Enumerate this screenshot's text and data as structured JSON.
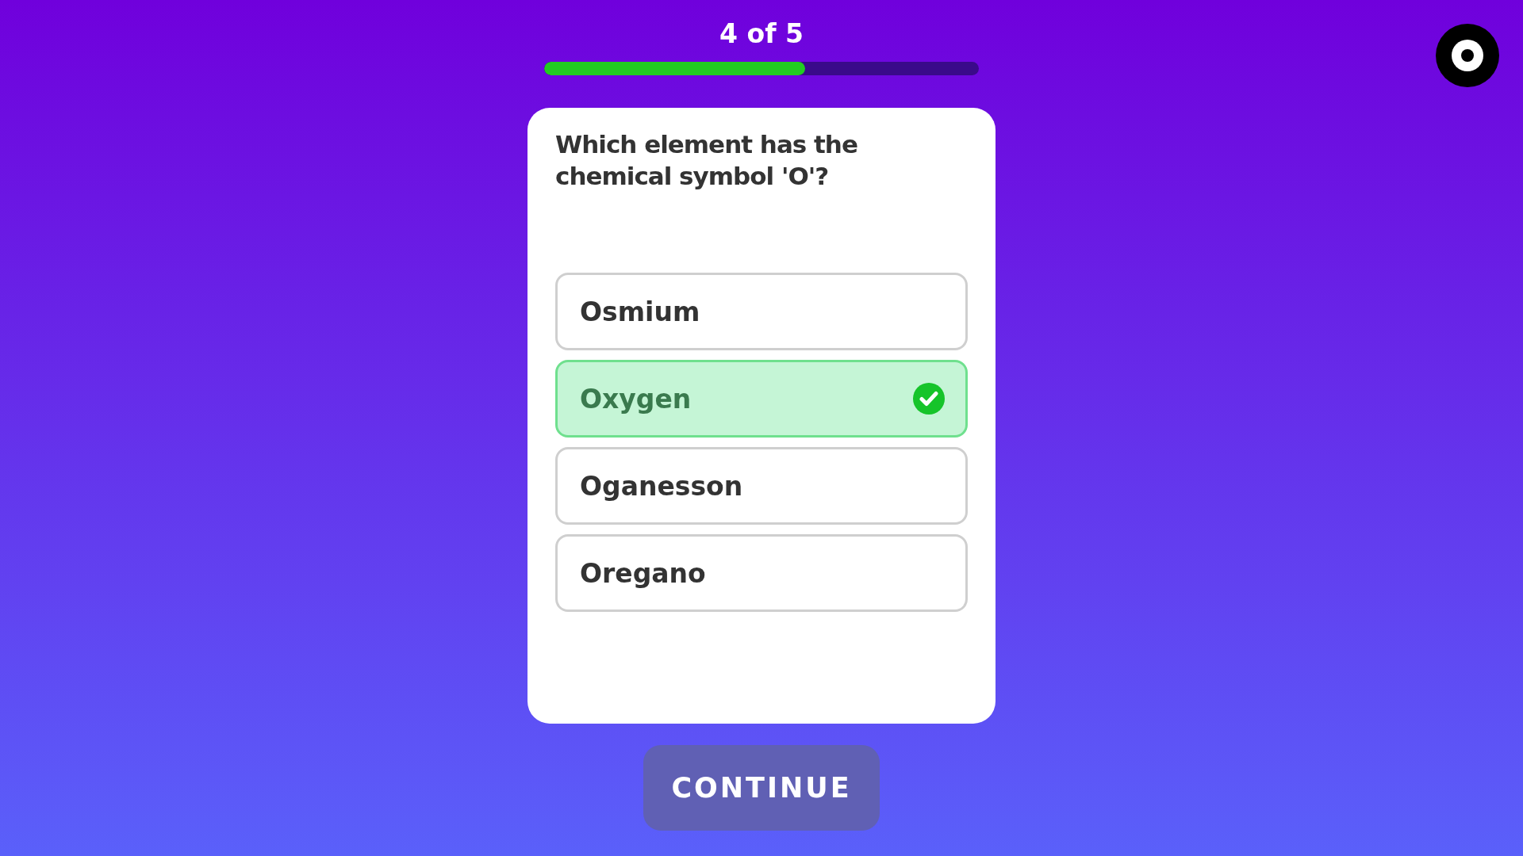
{
  "progress": {
    "label": "4 of 5",
    "level": 0.6
  },
  "question": "Which element has the chemical symbol 'O'?",
  "options": [
    {
      "label": "Osmium",
      "selected": false
    },
    {
      "label": "Oxygen",
      "selected": true
    },
    {
      "label": "Oganesson",
      "selected": false
    },
    {
      "label": "Oregano",
      "selected": false
    }
  ],
  "continue_button": {
    "label": "CONTINUE",
    "disabled": true
  }
}
